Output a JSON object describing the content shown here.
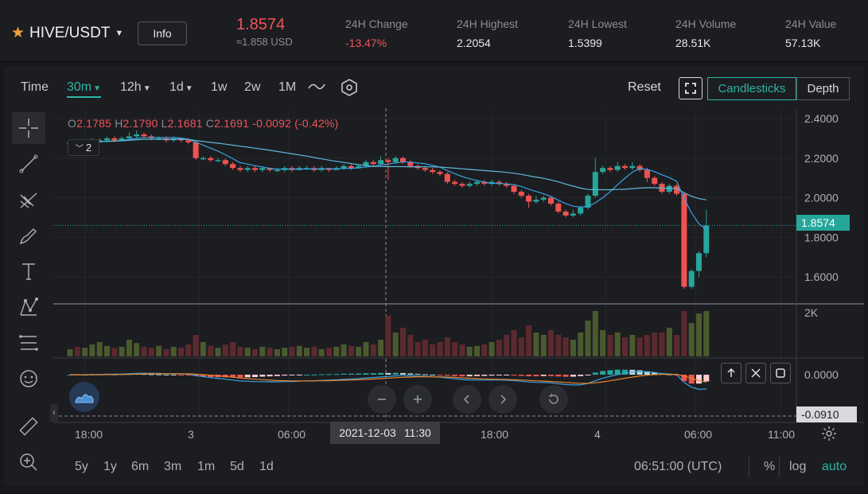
{
  "header": {
    "pair": "HIVE/USDT",
    "info_label": "Info",
    "last_price": "1.8574",
    "last_price_usd": "≈1.858 USD",
    "stats": [
      {
        "key": "24H Change",
        "value": "-13.47%",
        "negative": true
      },
      {
        "key": "24H Highest",
        "value": "2.2054",
        "negative": false
      },
      {
        "key": "24H Lowest",
        "value": "1.5399",
        "negative": false
      },
      {
        "key": "24H Volume",
        "value": "28.51K",
        "negative": false
      },
      {
        "key": "24H Value",
        "value": "57.13K",
        "negative": false
      }
    ]
  },
  "toolbar": {
    "time_label": "Time",
    "intervals": [
      "30m",
      "12h",
      "1d",
      "1w",
      "2w",
      "1M"
    ],
    "active_interval": "30m",
    "reset_label": "Reset",
    "candlesticks_label": "Candlesticks",
    "depth_label": "Depth"
  },
  "tools": [
    "crosshair-icon",
    "trend-line-icon",
    "pitchfork-icon",
    "brush-icon",
    "text-icon",
    "pattern-icon",
    "ruler-lines-icon",
    "emoji-icon",
    "measure-icon",
    "zoom-in-icon"
  ],
  "legend": {
    "o_label": "O",
    "o_value": "2.1785",
    "h_label": "H",
    "h_value": "2.1790",
    "l_label": "L",
    "l_value": "2.1681",
    "c_label": "C",
    "c_value": "2.1691",
    "change": "-0.0092 (-0.42%)",
    "indicator_count": "2"
  },
  "price_axis": [
    "2.4000",
    "2.2000",
    "2.0000",
    "1.8000",
    "1.6000"
  ],
  "volume_axis": "2K",
  "macd_axis": "0.0000",
  "current_price_tag": "1.8574",
  "macd_tag": "-0.0910",
  "time_axis": [
    "18:00",
    "3",
    "06:00",
    "18:00",
    "4",
    "06:00",
    "11:00"
  ],
  "crosshair_time": {
    "date": "2021-12-03",
    "time": "11:30"
  },
  "bottom": {
    "ranges": [
      "5y",
      "1y",
      "6m",
      "3m",
      "1m",
      "5d",
      "1d"
    ],
    "clock": "06:51:00 (UTC)",
    "percent_label": "%",
    "log_label": "log",
    "auto_label": "auto"
  },
  "colors": {
    "up": "#26a69a",
    "down": "#ef5350",
    "accent": "#2bb5a4",
    "ma_fast": "#3aa3e3",
    "ma_slow": "#e8832a"
  },
  "chart_data": {
    "type": "candlestick",
    "price_range": [
      1.5,
      2.42
    ],
    "candles": [
      [
        2.27,
        2.28,
        2.26,
        2.29
      ],
      [
        2.28,
        2.27,
        2.26,
        2.29
      ],
      [
        2.27,
        2.28,
        2.27,
        2.29
      ],
      [
        2.28,
        2.29,
        2.27,
        2.3
      ],
      [
        2.29,
        2.29,
        2.28,
        2.3
      ],
      [
        2.29,
        2.3,
        2.28,
        2.31
      ],
      [
        2.3,
        2.29,
        2.28,
        2.31
      ],
      [
        2.29,
        2.3,
        2.29,
        2.31
      ],
      [
        2.3,
        2.31,
        2.29,
        2.33
      ],
      [
        2.31,
        2.32,
        2.3,
        2.34
      ],
      [
        2.32,
        2.31,
        2.3,
        2.33
      ],
      [
        2.31,
        2.3,
        2.29,
        2.32
      ],
      [
        2.3,
        2.3,
        2.29,
        2.31
      ],
      [
        2.3,
        2.29,
        2.28,
        2.31
      ],
      [
        2.29,
        2.3,
        2.28,
        2.31
      ],
      [
        2.3,
        2.29,
        2.28,
        2.3
      ],
      [
        2.29,
        2.28,
        2.27,
        2.3
      ],
      [
        2.28,
        2.2,
        2.19,
        2.29
      ],
      [
        2.2,
        2.2,
        2.19,
        2.21
      ],
      [
        2.2,
        2.19,
        2.18,
        2.21
      ],
      [
        2.19,
        2.19,
        2.18,
        2.2
      ],
      [
        2.19,
        2.17,
        2.16,
        2.2
      ],
      [
        2.17,
        2.15,
        2.14,
        2.18
      ],
      [
        2.15,
        2.14,
        2.13,
        2.16
      ],
      [
        2.14,
        2.15,
        2.13,
        2.16
      ],
      [
        2.15,
        2.14,
        2.13,
        2.16
      ],
      [
        2.14,
        2.15,
        2.13,
        2.16
      ],
      [
        2.15,
        2.14,
        2.13,
        2.15
      ],
      [
        2.14,
        2.14,
        2.13,
        2.15
      ],
      [
        2.14,
        2.15,
        2.13,
        2.16
      ],
      [
        2.15,
        2.14,
        2.13,
        2.16
      ],
      [
        2.14,
        2.15,
        2.14,
        2.16
      ],
      [
        2.15,
        2.15,
        2.14,
        2.16
      ],
      [
        2.15,
        2.14,
        2.13,
        2.16
      ],
      [
        2.14,
        2.15,
        2.13,
        2.16
      ],
      [
        2.15,
        2.14,
        2.13,
        2.15
      ],
      [
        2.14,
        2.15,
        2.14,
        2.16
      ],
      [
        2.15,
        2.16,
        2.14,
        2.17
      ],
      [
        2.16,
        2.15,
        2.14,
        2.17
      ],
      [
        2.15,
        2.16,
        2.15,
        2.17
      ],
      [
        2.16,
        2.18,
        2.15,
        2.19
      ],
      [
        2.18,
        2.17,
        2.16,
        2.19
      ],
      [
        2.17,
        2.19,
        2.16,
        2.21
      ],
      [
        2.19,
        2.18,
        2.09,
        2.2
      ],
      [
        2.18,
        2.2,
        2.17,
        2.21
      ],
      [
        2.2,
        2.18,
        2.17,
        2.21
      ],
      [
        2.18,
        2.16,
        2.15,
        2.19
      ],
      [
        2.16,
        2.15,
        2.14,
        2.17
      ],
      [
        2.15,
        2.14,
        2.13,
        2.16
      ],
      [
        2.14,
        2.13,
        2.12,
        2.15
      ],
      [
        2.13,
        2.12,
        2.11,
        2.14
      ],
      [
        2.12,
        2.08,
        2.07,
        2.13
      ],
      [
        2.08,
        2.07,
        2.06,
        2.09
      ],
      [
        2.07,
        2.06,
        2.05,
        2.08
      ],
      [
        2.06,
        2.07,
        2.05,
        2.08
      ],
      [
        2.07,
        2.08,
        2.06,
        2.09
      ],
      [
        2.08,
        2.07,
        2.06,
        2.09
      ],
      [
        2.07,
        2.08,
        2.06,
        2.09
      ],
      [
        2.08,
        2.07,
        2.06,
        2.09
      ],
      [
        2.07,
        2.06,
        2.05,
        2.08
      ],
      [
        2.06,
        2.03,
        2.02,
        2.07
      ],
      [
        2.03,
        2.01,
        2.0,
        2.04
      ],
      [
        2.01,
        1.98,
        1.95,
        2.02
      ],
      [
        1.98,
        1.99,
        1.97,
        2.01
      ],
      [
        1.99,
        2.0,
        1.98,
        2.01
      ],
      [
        2.0,
        1.97,
        1.96,
        2.01
      ],
      [
        1.97,
        1.93,
        1.92,
        1.98
      ],
      [
        1.93,
        1.91,
        1.9,
        1.94
      ],
      [
        1.91,
        1.92,
        1.9,
        1.94
      ],
      [
        1.92,
        1.95,
        1.91,
        1.96
      ],
      [
        1.95,
        2.01,
        1.94,
        2.02
      ],
      [
        2.01,
        2.13,
        2.0,
        2.2
      ],
      [
        2.13,
        2.15,
        2.12,
        2.16
      ],
      [
        2.15,
        2.14,
        2.13,
        2.16
      ],
      [
        2.14,
        2.16,
        2.13,
        2.18
      ],
      [
        2.16,
        2.15,
        2.14,
        2.17
      ],
      [
        2.15,
        2.16,
        2.14,
        2.18
      ],
      [
        2.16,
        2.14,
        2.13,
        2.17
      ],
      [
        2.14,
        2.1,
        2.08,
        2.15
      ],
      [
        2.1,
        2.07,
        2.06,
        2.11
      ],
      [
        2.07,
        2.03,
        2.02,
        2.08
      ],
      [
        2.03,
        2.06,
        2.02,
        2.07
      ],
      [
        2.06,
        2.02,
        2.01,
        2.07
      ],
      [
        2.02,
        1.55,
        1.54,
        2.03
      ],
      [
        1.55,
        1.63,
        1.54,
        1.64
      ],
      [
        1.63,
        1.72,
        1.6,
        1.73
      ],
      [
        1.72,
        1.86,
        1.7,
        1.94
      ]
    ],
    "volumes": [
      0.15,
      0.2,
      0.18,
      0.25,
      0.3,
      0.22,
      0.18,
      0.2,
      0.35,
      0.28,
      0.2,
      0.18,
      0.22,
      0.15,
      0.2,
      0.18,
      0.25,
      0.45,
      0.3,
      0.22,
      0.18,
      0.25,
      0.3,
      0.2,
      0.18,
      0.15,
      0.2,
      0.18,
      0.15,
      0.18,
      0.2,
      0.22,
      0.18,
      0.2,
      0.15,
      0.18,
      0.2,
      0.25,
      0.22,
      0.2,
      0.3,
      0.25,
      0.35,
      0.85,
      0.5,
      0.6,
      0.45,
      0.3,
      0.35,
      0.25,
      0.3,
      0.4,
      0.3,
      0.25,
      0.2,
      0.22,
      0.25,
      0.3,
      0.35,
      0.45,
      0.55,
      0.4,
      0.65,
      0.5,
      0.45,
      0.55,
      0.45,
      0.4,
      0.35,
      0.5,
      0.75,
      0.95,
      0.55,
      0.45,
      0.5,
      0.4,
      0.45,
      0.4,
      0.45,
      0.5,
      0.5,
      0.6,
      0.45,
      0.95,
      0.7,
      0.9,
      0.95
    ]
  }
}
